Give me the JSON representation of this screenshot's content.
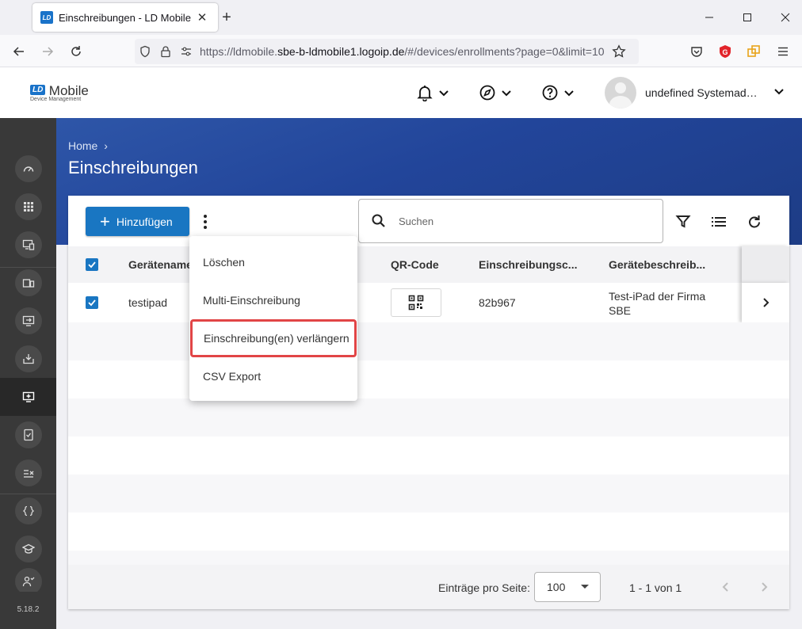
{
  "browser": {
    "tab_title": "Einschreibungen - LD Mobile",
    "tab_favicon": "LD",
    "url_prefix": "https://ldmobile.",
    "url_host": "sbe-b-ldmobile1.logoip.de",
    "url_path": "/#/devices/enrollments?page=0&limit=10"
  },
  "app": {
    "logo_mark": "LD",
    "logo_text": "Mobile",
    "logo_sub": "Device Management",
    "username": "undefined Systemadministrator"
  },
  "sidebar": {
    "version": "5.18.2",
    "items": [
      {
        "icon": "dashboard-icon"
      },
      {
        "icon": "apps-grid-icon"
      },
      {
        "icon": "device-management-icon"
      },
      {
        "icon": "devices-icon"
      },
      {
        "icon": "device-import-icon"
      },
      {
        "icon": "device-download-icon"
      },
      {
        "icon": "enrollment-icon",
        "active": true
      },
      {
        "icon": "compliance-icon"
      },
      {
        "icon": "rules-icon"
      },
      {
        "icon": "scripts-icon"
      },
      {
        "icon": "training-icon"
      },
      {
        "icon": "users-icon"
      }
    ]
  },
  "page": {
    "breadcrumb": "Home",
    "breadcrumb_sep": "›",
    "title": "Einschreibungen"
  },
  "toolbar": {
    "add_label": "Hinzufügen",
    "search_placeholder": "Suchen"
  },
  "table": {
    "columns": [
      "Gerätename",
      "QR-Code",
      "Einschreibungsc...",
      "Gerätebeschreib..."
    ],
    "rows": [
      {
        "checked": true,
        "device_name": "testipad",
        "enrollment_code": "82b967",
        "description": "Test-iPad der Firma SBE"
      }
    ]
  },
  "footer": {
    "per_page_label": "Einträge pro Seite:",
    "per_page_value": "100",
    "range": "1 - 1 von 1"
  },
  "menu": {
    "items": [
      {
        "label": "Löschen"
      },
      {
        "label": "Multi-Einschreibung"
      },
      {
        "label": "Einschreibung(en) verlängern",
        "highlighted": true
      },
      {
        "label": "CSV Export"
      }
    ]
  },
  "colors": {
    "primary": "#1976c2",
    "sidebar": "#393939",
    "highlight": "#e14546",
    "hero": "#2e56a8"
  }
}
